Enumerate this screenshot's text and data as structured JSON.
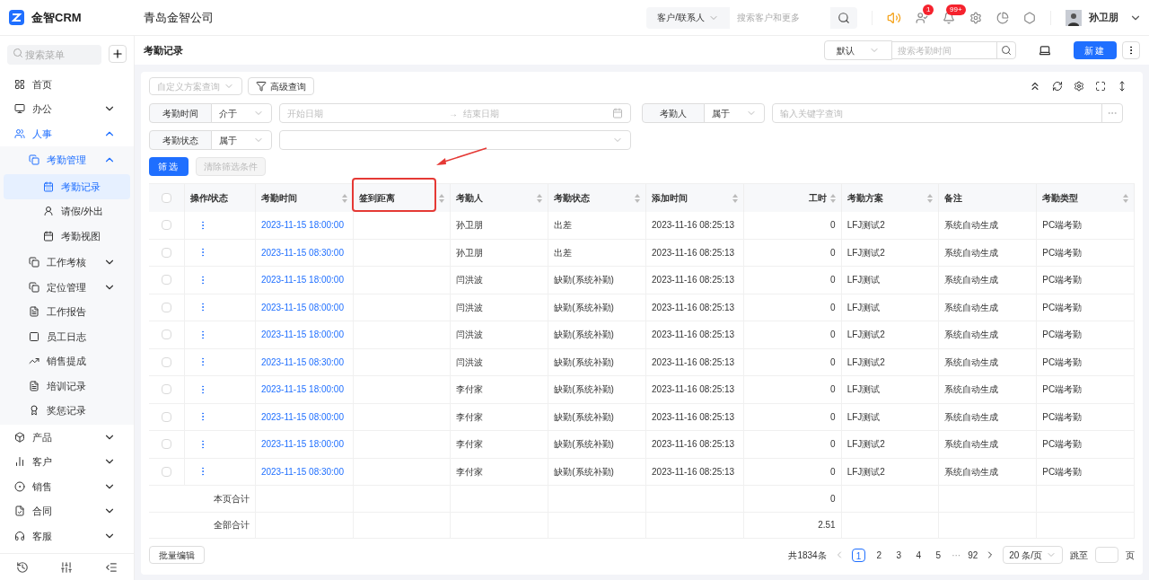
{
  "topbar": {
    "brand": "金智CRM",
    "company": "青岛金智公司",
    "search_scope": "客户/联系人",
    "search_placeholder": "搜索客户和更多",
    "badges": [
      "1",
      "99+"
    ],
    "user": "孙卫朋"
  },
  "sidebar": {
    "search_placeholder": "搜索菜单",
    "items": [
      {
        "label": "首页",
        "selected": false
      },
      {
        "label": "办公",
        "selected": false,
        "expanded": false
      },
      {
        "label": "人事",
        "selected": false,
        "expanded": true,
        "children": [
          {
            "label": "考勤管理",
            "selected": false,
            "expanded": true,
            "children": [
              {
                "label": "考勤记录",
                "selected": true
              },
              {
                "label": "请假/外出",
                "selected": false
              },
              {
                "label": "考勤视图",
                "selected": false
              }
            ]
          },
          {
            "label": "工作考核",
            "selected": false,
            "expanded": false
          },
          {
            "label": "定位管理",
            "selected": false,
            "expanded": false
          },
          {
            "label": "工作报告",
            "selected": false
          },
          {
            "label": "员工日志",
            "selected": false
          },
          {
            "label": "销售提成",
            "selected": false
          },
          {
            "label": "培训记录",
            "selected": false
          },
          {
            "label": "奖惩记录",
            "selected": false
          }
        ]
      },
      {
        "label": "产品",
        "selected": false,
        "expanded": false
      },
      {
        "label": "客户",
        "selected": false,
        "expanded": false
      },
      {
        "label": "销售",
        "selected": false,
        "expanded": false
      },
      {
        "label": "合同",
        "selected": false,
        "expanded": false
      },
      {
        "label": "客服",
        "selected": false,
        "expanded": false
      }
    ]
  },
  "page": {
    "title": "考勤记录",
    "view_select": "默认",
    "search_placeholder": "搜索考勤时间",
    "new_button": "新建"
  },
  "filters": {
    "scheme_placeholder": "自定义方案查询",
    "advanced_button": "高级查询",
    "conditions": [
      {
        "kind": "date_range",
        "label": "考勤时间",
        "operator": "介于",
        "start_placeholder": "开始日期",
        "range_separator": "→",
        "end_placeholder": "结束日期"
      },
      {
        "kind": "keyword",
        "label": "考勤人",
        "operator": "属于",
        "placeholder": "输入关键字查询"
      },
      {
        "kind": "select",
        "label": "考勤状态",
        "operator": "属于"
      }
    ],
    "apply_button": "筛选",
    "clear_button": {
      "label": "清除筛选条件",
      "disabled": true
    }
  },
  "table": {
    "select_all_checked": false,
    "columns": [
      {
        "label": "操作/状态",
        "sortable": false
      },
      {
        "label": "考勤时间",
        "sortable": true
      },
      {
        "label": "签到距离",
        "sortable": true
      },
      {
        "label": "考勤人",
        "sortable": true
      },
      {
        "label": "考勤状态",
        "sortable": true
      },
      {
        "label": "添加时间",
        "sortable": true
      },
      {
        "label": "工时",
        "sortable": true
      },
      {
        "label": "考勤方案",
        "sortable": true
      },
      {
        "label": "备注",
        "sortable": false
      },
      {
        "label": "考勤类型",
        "sortable": true
      }
    ],
    "rows": [
      {
        "checked": false,
        "time": "2023-11-15 18:00:00",
        "person": "孙卫朋",
        "status": "出差",
        "added": "2023-11-16 08:25:13",
        "hours": "0",
        "plan": "LFJ测试2",
        "note": "系统自动生成",
        "type": "PC端考勤"
      },
      {
        "checked": false,
        "time": "2023-11-15 08:30:00",
        "person": "孙卫朋",
        "status": "出差",
        "added": "2023-11-16 08:25:13",
        "hours": "0",
        "plan": "LFJ测试2",
        "note": "系统自动生成",
        "type": "PC端考勤"
      },
      {
        "checked": false,
        "time": "2023-11-15 18:00:00",
        "person": "闫洪波",
        "status": "缺勤(系统补勤)",
        "added": "2023-11-16 08:25:13",
        "hours": "0",
        "plan": "LFJ测试",
        "note": "系统自动生成",
        "type": "PC端考勤"
      },
      {
        "checked": false,
        "time": "2023-11-15 08:00:00",
        "person": "闫洪波",
        "status": "缺勤(系统补勤)",
        "added": "2023-11-16 08:25:13",
        "hours": "0",
        "plan": "LFJ测试",
        "note": "系统自动生成",
        "type": "PC端考勤"
      },
      {
        "checked": false,
        "time": "2023-11-15 18:00:00",
        "person": "闫洪波",
        "status": "缺勤(系统补勤)",
        "added": "2023-11-16 08:25:13",
        "hours": "0",
        "plan": "LFJ测试2",
        "note": "系统自动生成",
        "type": "PC端考勤"
      },
      {
        "checked": false,
        "time": "2023-11-15 08:30:00",
        "person": "闫洪波",
        "status": "缺勤(系统补勤)",
        "added": "2023-11-16 08:25:13",
        "hours": "0",
        "plan": "LFJ测试2",
        "note": "系统自动生成",
        "type": "PC端考勤"
      },
      {
        "checked": false,
        "time": "2023-11-15 18:00:00",
        "person": "李付家",
        "status": "缺勤(系统补勤)",
        "added": "2023-11-16 08:25:13",
        "hours": "0",
        "plan": "LFJ测试",
        "note": "系统自动生成",
        "type": "PC端考勤"
      },
      {
        "checked": false,
        "time": "2023-11-15 08:00:00",
        "person": "李付家",
        "status": "缺勤(系统补勤)",
        "added": "2023-11-16 08:25:13",
        "hours": "0",
        "plan": "LFJ测试",
        "note": "系统自动生成",
        "type": "PC端考勤"
      },
      {
        "checked": false,
        "time": "2023-11-15 18:00:00",
        "person": "李付家",
        "status": "缺勤(系统补勤)",
        "added": "2023-11-16 08:25:13",
        "hours": "0",
        "plan": "LFJ测试2",
        "note": "系统自动生成",
        "type": "PC端考勤"
      },
      {
        "checked": false,
        "time": "2023-11-15 08:30:00",
        "person": "李付家",
        "status": "缺勤(系统补勤)",
        "added": "2023-11-16 08:25:13",
        "hours": "0",
        "plan": "LFJ测试2",
        "note": "系统自动生成",
        "type": "PC端考勤"
      }
    ],
    "summary": [
      {
        "label": "本页合计",
        "hours": "0"
      },
      {
        "label": "全部合计",
        "hours": "2.51"
      }
    ]
  },
  "footer": {
    "bulk_edit": "批量编辑",
    "total": "共1834条",
    "pages": [
      {
        "label": "1",
        "selected": true
      },
      {
        "label": "2",
        "selected": false
      },
      {
        "label": "3",
        "selected": false
      },
      {
        "label": "4",
        "selected": false
      },
      {
        "label": "5",
        "selected": false
      }
    ],
    "ellipsis": "···",
    "last_page": "92",
    "page_size": "20 条/页",
    "jump_label": "跳至",
    "jump_suffix": "页"
  }
}
